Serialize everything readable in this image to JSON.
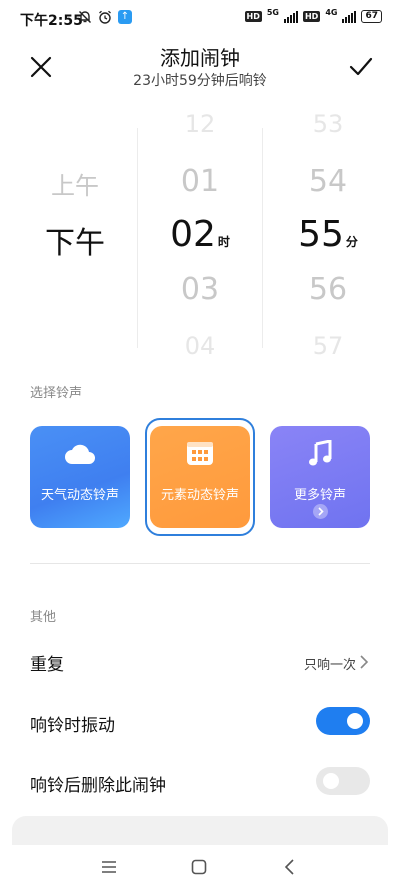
{
  "status_bar": {
    "time": "下午2:55",
    "network_1": "5G",
    "network_2": "4G",
    "hd_1": "HD",
    "hd_2": "HD",
    "battery": "67"
  },
  "header": {
    "title": "添加闹钟",
    "subtitle": "23小时59分钟后响铃",
    "close_icon": "close-icon",
    "confirm_icon": "check-icon"
  },
  "picker": {
    "ampm_options": [
      "上午",
      "下午"
    ],
    "ampm_selected": "下午",
    "hours": [
      "12",
      "01",
      "02",
      "03",
      "04"
    ],
    "hour_selected": "02",
    "hour_unit": "时",
    "minutes": [
      "53",
      "54",
      "55",
      "56",
      "57"
    ],
    "minute_selected": "55",
    "minute_unit": "分"
  },
  "ringtone_section": {
    "label": "选择铃声",
    "cards": [
      {
        "label": "天气动态铃声",
        "icon": "cloud-icon",
        "color": "#4a8ff5"
      },
      {
        "label": "元素动态铃声",
        "icon": "calendar-grid-icon",
        "color": "#ffa043",
        "selected": true
      },
      {
        "label": "更多铃声",
        "icon": "music-note-icon",
        "color": "#7d7bf3"
      }
    ]
  },
  "other_section": {
    "label": "其他",
    "repeat_label": "重复",
    "repeat_value": "只响一次",
    "vibrate_label": "响铃时振动",
    "vibrate_on": true,
    "delete_label": "响铃后删除此闹钟",
    "delete_on": false
  },
  "colors": {
    "accent": "#1f7ef0",
    "selected_border": "#2f7fdc"
  },
  "nav_bar": {
    "menu_icon": "menu-icon",
    "home_icon": "home-square-icon",
    "back_icon": "back-chevron-icon"
  }
}
